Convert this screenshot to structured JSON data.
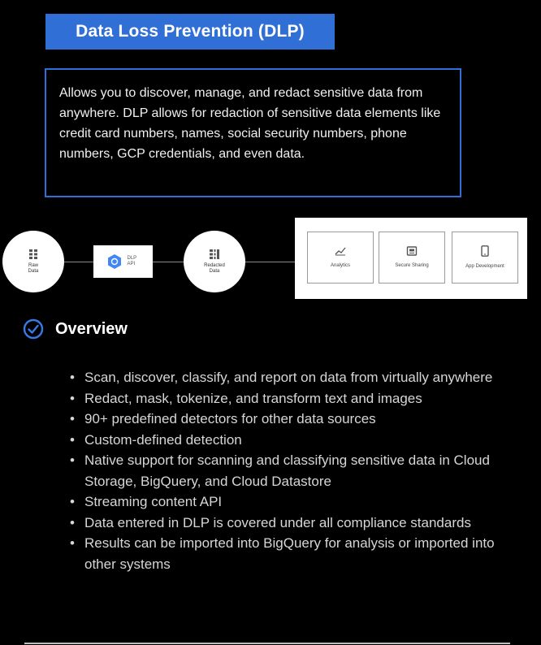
{
  "title": "Data Loss Prevention (DLP)",
  "description": "Allows you to discover, manage, and redact sensitive data from anywhere. DLP allows for redaction of sensitive data elements like credit card numbers, names, social security numbers, phone numbers, GCP credentials, and even data.",
  "diagram": {
    "raw_data_label": "Raw Data",
    "dlp_api_label": "DLP API",
    "redacted_data_label": "Redacted Data",
    "tiles": [
      {
        "label": "Analytics",
        "icon": "chart-icon"
      },
      {
        "label": "Secure Sharing",
        "icon": "share-icon"
      },
      {
        "label": "App Development",
        "icon": "phone-icon"
      }
    ]
  },
  "overview": {
    "heading": "Overview",
    "bullet_char": "•",
    "bullets": [
      "Scan, discover, classify, and report on data from virtually anywhere",
      "Redact, mask, tokenize, and transform text and images",
      "90+ predefined detectors for other data sources",
      "Custom-defined detection",
      "Native support for scanning and classifying sensitive data in Cloud Storage, BigQuery, and Cloud Datastore",
      "Streaming content API",
      "Data entered in DLP is covered under all compliance standards",
      "Results can be imported into BigQuery for analysis or imported into other systems"
    ]
  },
  "colors": {
    "accent": "#2f6fd6",
    "background": "#000000",
    "text": "#d6d6d6"
  }
}
